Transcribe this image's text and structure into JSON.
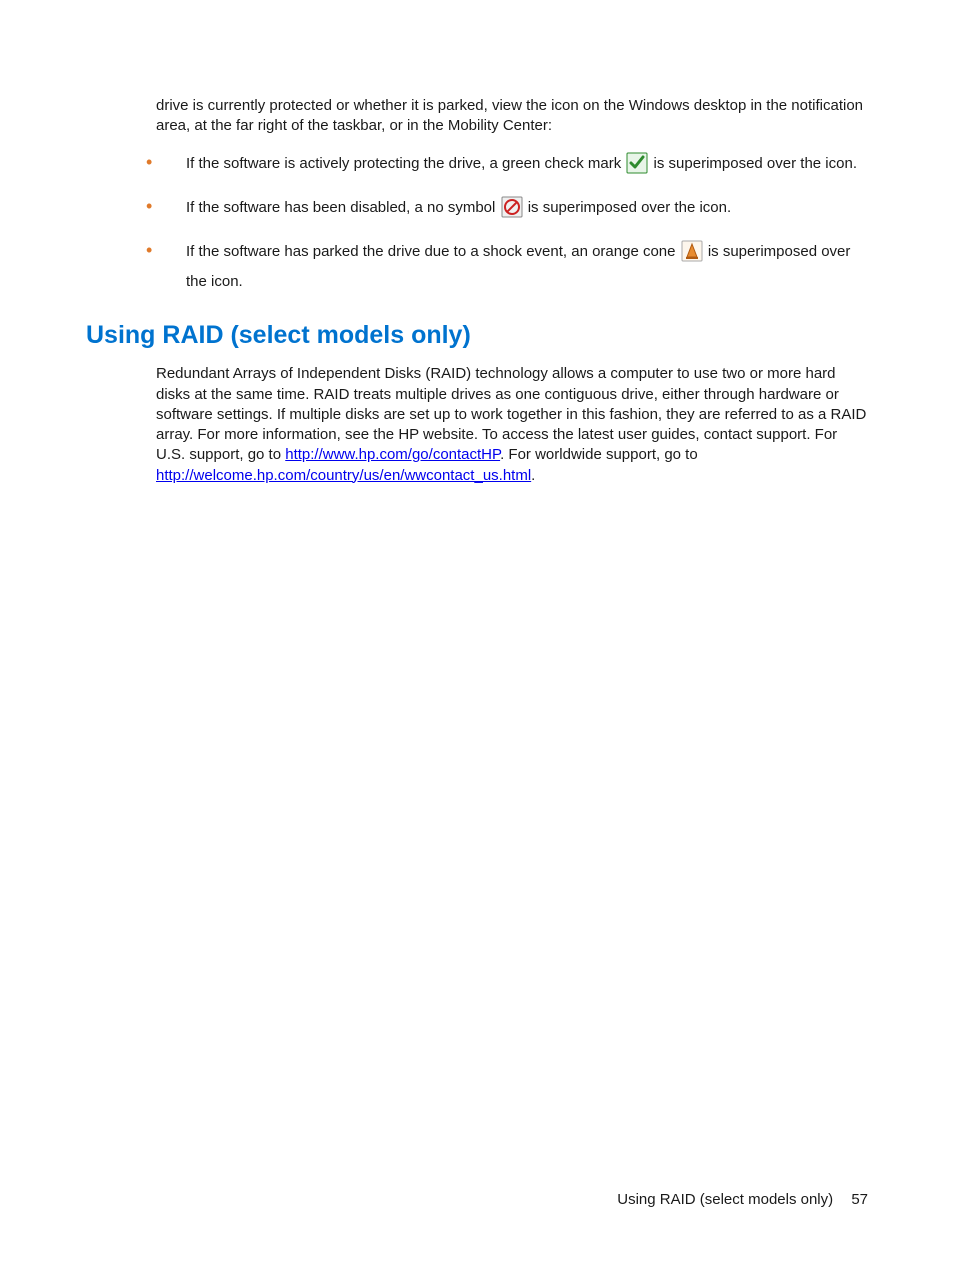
{
  "intro": "drive is currently protected or whether it is parked, view the icon on the Windows desktop in the notification area, at the far right of the taskbar, or in the Mobility Center:",
  "bullets": {
    "b1_a": "If the software is actively protecting the drive, a green check mark ",
    "b1_b": " is superimposed over the icon.",
    "b2_a": "If the software has been disabled, a no symbol ",
    "b2_b": " is superimposed over the icon.",
    "b3_a": "If the software has parked the drive due to a shock event, an orange cone",
    "b3_b": " is superimposed over the icon."
  },
  "heading": "Using RAID (select models only)",
  "raid": {
    "p1": "Redundant Arrays of Independent Disks (RAID) technology allows a computer to use two or more hard disks at the same time. RAID treats multiple drives as one contiguous drive, either through hardware or software settings. If multiple disks are set up to work together in this fashion, they are referred to as a RAID array. For more information, see the HP website. To access the latest user guides, contact support. For U.S. support, go to ",
    "link1": "http://www.hp.com/go/contactHP",
    "p2": ". For worldwide support, go to ",
    "link2": "http://welcome.hp.com/country/us/en/wwcontact_us.html",
    "p3": "."
  },
  "footer": {
    "title": "Using RAID (select models only)",
    "page": "57"
  }
}
